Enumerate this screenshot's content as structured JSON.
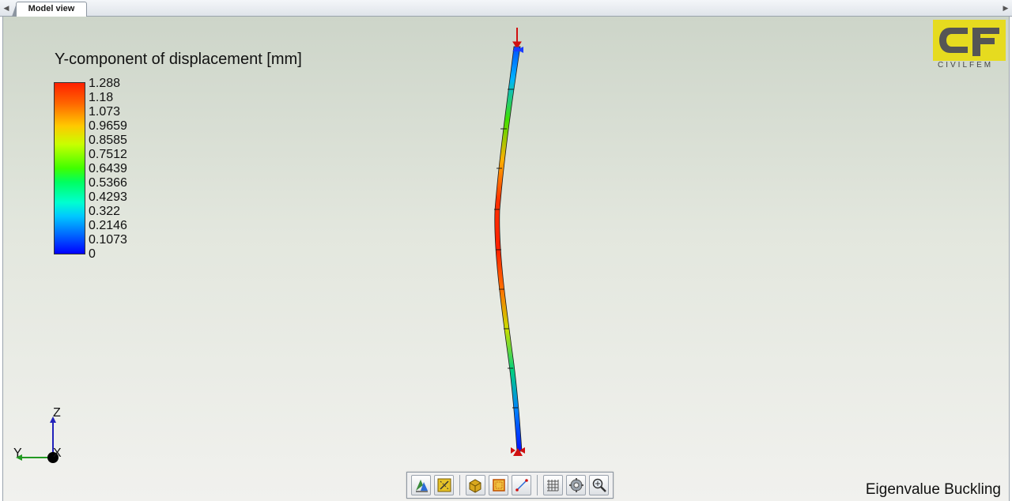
{
  "tabs": [
    {
      "label": "Model view",
      "active": true
    }
  ],
  "legend": {
    "title": "Y-component of displacement [mm]",
    "ticks": [
      "1.288",
      "1.18",
      "1.073",
      "0.9659",
      "0.8585",
      "0.7512",
      "0.6439",
      "0.5366",
      "0.4293",
      "0.322",
      "0.2146",
      "0.1073",
      "0"
    ],
    "colormap_top": "#ff2000",
    "colormap_bottom": "#0000ff"
  },
  "logo": {
    "text": "CIVILFEM",
    "color": "#e6db1f"
  },
  "triad": {
    "z_label": "Z",
    "y_label": "Y",
    "x_label": "X"
  },
  "analysis_label": "Eigenvalue Buckling",
  "toolbar": {
    "buttons": [
      {
        "icon": "result-contour-icon"
      },
      {
        "icon": "deformed-shape-icon"
      },
      {
        "icon": "solid-view-icon"
      },
      {
        "icon": "wireframe-box-icon"
      },
      {
        "icon": "line-view-icon"
      },
      {
        "icon": "mesh-grid-icon"
      },
      {
        "icon": "settings-gear-icon"
      },
      {
        "icon": "zoom-fit-icon"
      }
    ]
  }
}
